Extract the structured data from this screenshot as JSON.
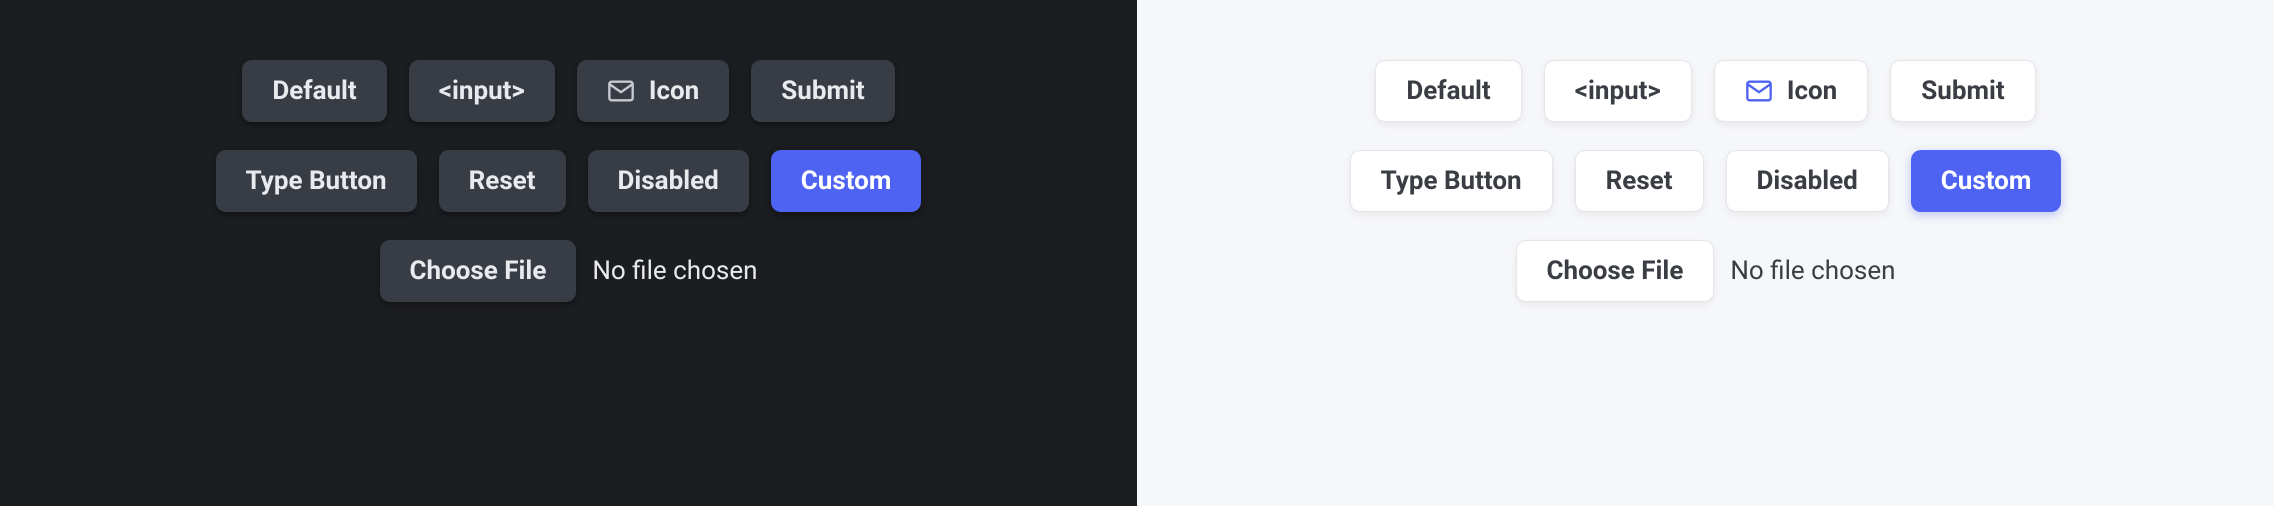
{
  "buttons": {
    "default": "Default",
    "input": "<input>",
    "icon": "Icon",
    "submit": "Submit",
    "type_button": "Type Button",
    "reset": "Reset",
    "disabled": "Disabled",
    "custom": "Custom",
    "choose_file": "Choose File"
  },
  "file_status": "No file chosen",
  "colors": {
    "dark_bg": "#1b1d21",
    "light_bg": "#f6f7f9",
    "dark_btn": "#383c44",
    "light_btn": "#ffffff",
    "accent": "#4f63f2"
  }
}
